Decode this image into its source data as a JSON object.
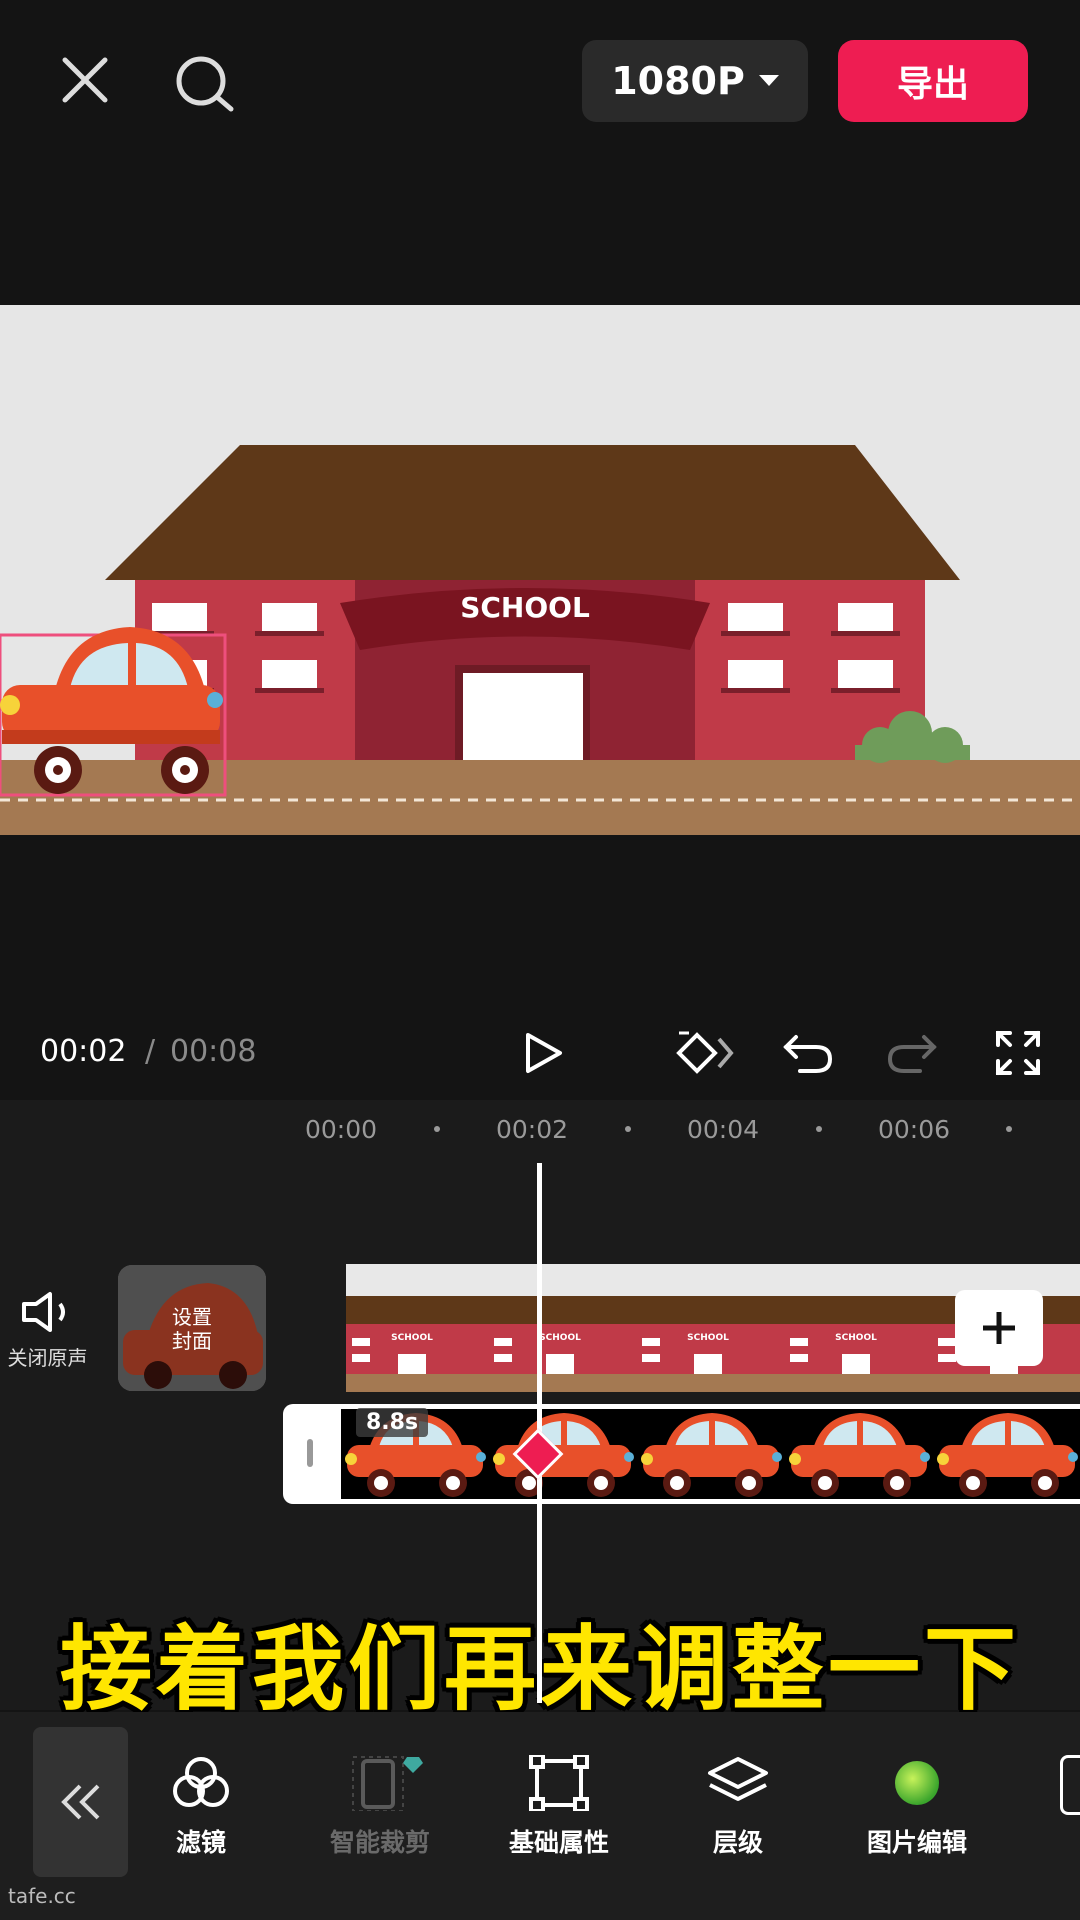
{
  "topbar": {
    "resolution": "1080P",
    "export_label": "导出"
  },
  "preview": {
    "school_sign": "SCHOOL"
  },
  "playback": {
    "current_time": "00:02",
    "separator": "/",
    "total_time": "00:08"
  },
  "timeline": {
    "ticks": [
      "00:00",
      "00:02",
      "00:04",
      "00:06"
    ],
    "mute_label": "关闭原声",
    "cover_label_line1": "设置",
    "cover_label_line2": "封面",
    "clip_duration": "8.8s",
    "mini_sign": "SCHOOL"
  },
  "subtitle": "接着我们再来调整一下",
  "toolbar": {
    "items": [
      {
        "label": "滤镜",
        "icon": "filter-icon"
      },
      {
        "label": "智能裁剪",
        "icon": "smart-crop-icon"
      },
      {
        "label": "基础属性",
        "icon": "transform-icon"
      },
      {
        "label": "层级",
        "icon": "layers-icon"
      },
      {
        "label": "图片编辑",
        "icon": "image-edit-icon"
      }
    ]
  },
  "watermark": "tafe.cc",
  "colors": {
    "accent": "#ee1d52",
    "subtitle": "#ffe600",
    "background": "#141414"
  }
}
